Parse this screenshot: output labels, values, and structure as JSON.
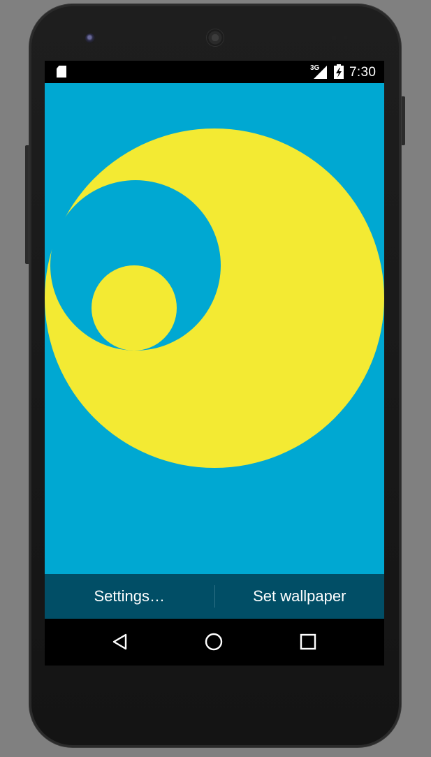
{
  "status_bar": {
    "network_type": "3G",
    "time": "7:30",
    "icons": [
      "sd-card-icon",
      "cell-signal-icon",
      "battery-charging-icon"
    ]
  },
  "wallpaper": {
    "background_color": "#00a8d2",
    "shape_color": "#f3ea33"
  },
  "action_bar": {
    "settings_label": "Settings…",
    "set_wallpaper_label": "Set wallpaper",
    "background_color": "#014e66"
  },
  "nav_bar": {
    "icons": [
      "back-icon",
      "home-icon",
      "recents-icon"
    ]
  }
}
